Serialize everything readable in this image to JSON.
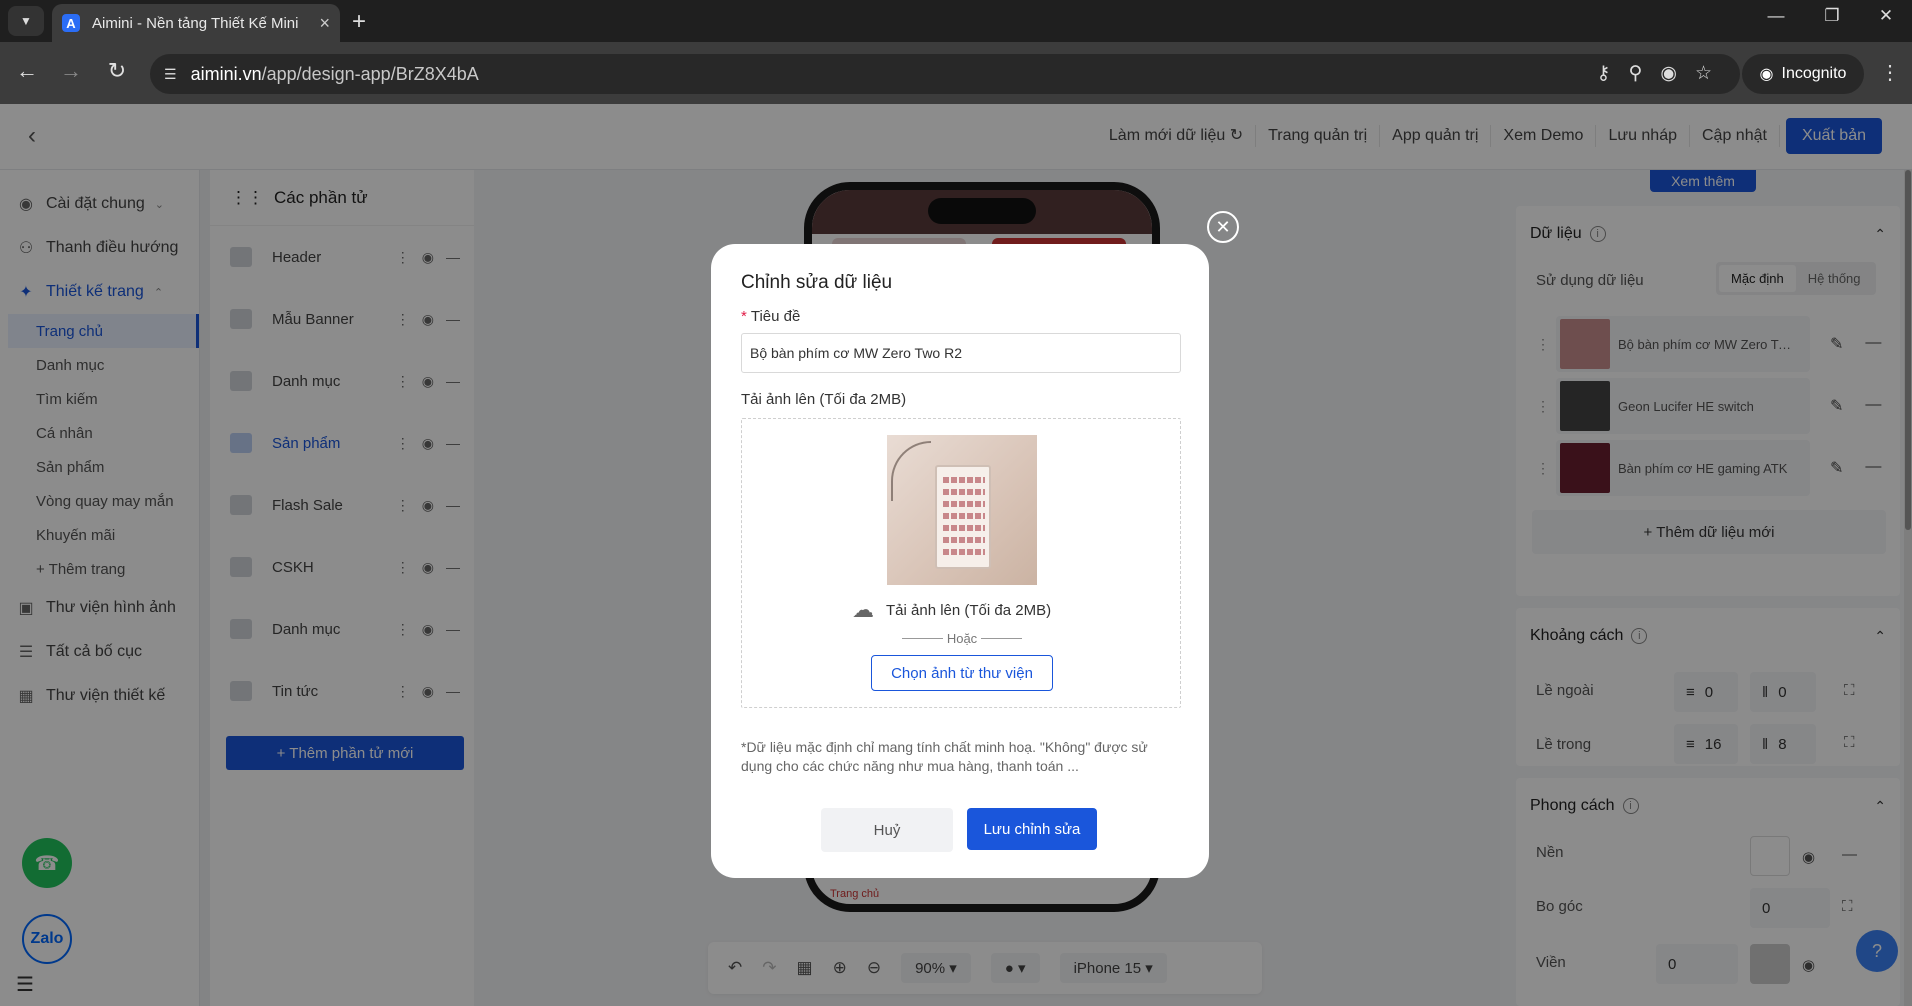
{
  "browser": {
    "tab_title": "Aimini - Nền tảng Thiết Kế Mini",
    "favicon_letter": "A",
    "url_host": "aimini.vn",
    "url_path": "/app/design-app/BrZ8X4bA",
    "incognito_label": "Incognito"
  },
  "header": {
    "refresh_label": "Làm mới dữ liệu",
    "links": [
      "Trang quản trị",
      "App quản trị",
      "Xem Demo",
      "Lưu nháp",
      "Cập nhật"
    ],
    "publish_label": "Xuất bản"
  },
  "sidebar": {
    "general": "Cài đặt chung",
    "navigation": "Thanh điều hướng",
    "page_design": "Thiết kế trang",
    "pages": [
      "Trang chủ",
      "Danh mục",
      "Tìm kiếm",
      "Cá nhân",
      "Sản phẩm",
      "Vòng quay may mắn",
      "Khuyến mãi"
    ],
    "add_page": "+ Thêm trang",
    "image_library": "Thư viện hình ảnh",
    "all_layouts": "Tất cả bố cục",
    "design_library": "Thư viện thiết kế",
    "zalo_label": "Zalo"
  },
  "elements": {
    "title": "Các phần tử",
    "items": [
      "Header",
      "Mẫu Banner",
      "Danh mục",
      "Sản phẩm",
      "Flash Sale",
      "CSKH",
      "Danh mục",
      "Tin tức"
    ],
    "add_button": "+ Thêm phần tử mới"
  },
  "canvas": {
    "phone_footer": "Trang chủ",
    "zoom": "90%",
    "device": "iPhone 15"
  },
  "right_panel": {
    "see_more": "Xem thêm",
    "data_section": "Dữ liệu",
    "use_data_label": "Sử dụng dữ liệu",
    "seg_default": "Mặc định",
    "seg_system": "Hệ thống",
    "data_items": [
      "Bộ bàn phím cơ MW Zero Two R2",
      "Geon Lucifer HE switch",
      "Bàn phím cơ HE gaming ATK"
    ],
    "add_data": "+ Thêm dữ liệu mới",
    "spacing_section": "Khoảng cách",
    "margin_label": "Lề ngoài",
    "margin_v": "0",
    "margin_h": "0",
    "padding_label": "Lề trong",
    "padding_v": "16",
    "padding_h": "8",
    "style_section": "Phong cách",
    "bg_label": "Nền",
    "radius_label": "Bo góc",
    "radius_value": "0",
    "border_label": "Viền",
    "border_value": "0"
  },
  "modal": {
    "title": "Chỉnh sửa dữ liệu",
    "title_field_label": "Tiêu đề",
    "title_field_value": "Bộ bàn phím cơ MW Zero Two R2",
    "upload_label": "Tải ảnh lên (Tối đa 2MB)",
    "upload_link": "Tải ảnh lên (Tối đa 2MB)",
    "or_text": "Hoặc",
    "library_button": "Chọn ảnh từ thư viện",
    "note": "*Dữ liệu mặc định chỉ mang tính chất minh hoạ. \"Không\" được sử dụng cho các chức năng như mua hàng, thanh toán ...",
    "cancel": "Huỷ",
    "save": "Lưu chỉnh sửa"
  },
  "colors": {
    "primary": "#1a56db",
    "phone_green": "#22c55e",
    "zalo_blue": "#0068ff"
  }
}
